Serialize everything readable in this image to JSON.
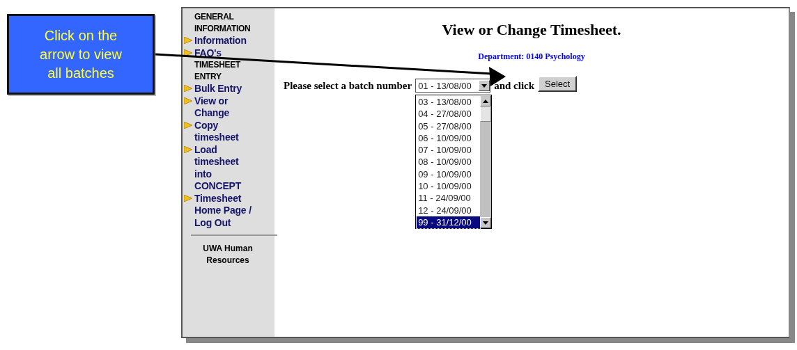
{
  "callout": {
    "text": "Click on the arrow to view all batches"
  },
  "sidebar": {
    "items": [
      {
        "kind": "heading",
        "label": "GENERAL INFORMATION"
      },
      {
        "kind": "link",
        "label": "Information"
      },
      {
        "kind": "link",
        "label": "FAQ's"
      },
      {
        "kind": "heading",
        "label": "TIMESHEET ENTRY"
      },
      {
        "kind": "link",
        "label": "Bulk Entry"
      },
      {
        "kind": "link",
        "label": "View or Change"
      },
      {
        "kind": "link",
        "label": "Copy timesheet"
      },
      {
        "kind": "link",
        "label": "Load timesheet into CONCEPT"
      },
      {
        "kind": "link",
        "label": "Timesheet Home Page / Log Out"
      },
      {
        "kind": "divider"
      },
      {
        "kind": "footer",
        "label": "UWA Human Resources"
      }
    ]
  },
  "title": "View or Change Timesheet.",
  "department": "Department: 0140 Psychology",
  "prompt": "Please select a batch number",
  "batch_select": {
    "value": "01 - 13/08/00",
    "options": [
      {
        "label": "03 - 13/08/00",
        "selected": false
      },
      {
        "label": "04 - 27/08/00",
        "selected": false
      },
      {
        "label": "05 - 27/08/00",
        "selected": false
      },
      {
        "label": "06 - 10/09/00",
        "selected": false
      },
      {
        "label": "07 - 10/09/00",
        "selected": false
      },
      {
        "label": "08 - 10/09/00",
        "selected": false
      },
      {
        "label": "09 - 10/09/00",
        "selected": false
      },
      {
        "label": "10 - 10/09/00",
        "selected": false
      },
      {
        "label": "11 - 24/09/00",
        "selected": false
      },
      {
        "label": "12 - 24/09/00",
        "selected": false
      },
      {
        "label": "99 - 31/12/00",
        "selected": true
      }
    ]
  },
  "after_select": "and click",
  "button": "Select"
}
